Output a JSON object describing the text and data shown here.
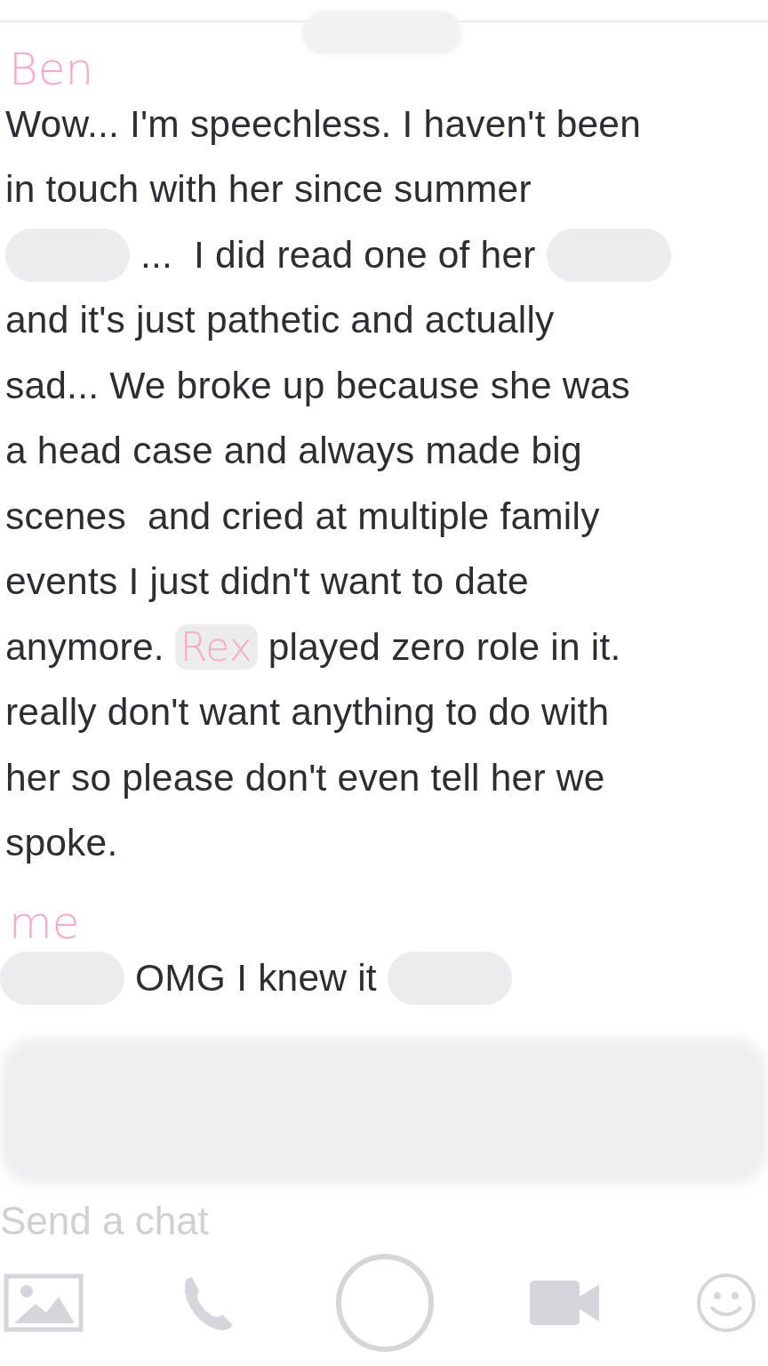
{
  "messages": [
    {
      "sender": "Ben",
      "lines": [
        [
          {
            "kind": "text",
            "text": "Wow... I'm speechless. I haven't been"
          }
        ],
        [
          {
            "kind": "text",
            "text": "in touch with her since summer"
          }
        ],
        [
          {
            "kind": "redacted"
          },
          {
            "kind": "text",
            "text": "...  I did read one of her"
          },
          {
            "kind": "redacted"
          }
        ],
        [
          {
            "kind": "text",
            "text": "and it's just pathetic and actually"
          }
        ],
        [
          {
            "kind": "text",
            "text": "sad... We broke up because she was"
          }
        ],
        [
          {
            "kind": "text",
            "text": "a head case and always made big"
          }
        ],
        [
          {
            "kind": "text",
            "text": "scenes  and cried at multiple family"
          }
        ],
        [
          {
            "kind": "text",
            "text": "events I just didn't want to date"
          }
        ],
        [
          {
            "kind": "text",
            "text": "anymore."
          },
          {
            "kind": "annotation",
            "text": "Rex"
          },
          {
            "kind": "text",
            "text": "played zero role in it."
          }
        ],
        [
          {
            "kind": "text",
            "text": "really don't want anything to do with"
          }
        ],
        [
          {
            "kind": "text",
            "text": "her so please don't even tell her we"
          }
        ],
        [
          {
            "kind": "text",
            "text": "spoke."
          }
        ]
      ]
    },
    {
      "sender": "me",
      "lines": [
        [
          {
            "kind": "redacted"
          },
          {
            "kind": "text",
            "text": "OMG I knew it"
          },
          {
            "kind": "redacted"
          }
        ]
      ]
    }
  ],
  "input": {
    "placeholder": "Send a chat"
  },
  "toolbar": [
    {
      "kind": "image"
    },
    {
      "kind": "call"
    },
    {
      "kind": "capture"
    },
    {
      "kind": "video"
    },
    {
      "kind": "emoji"
    }
  ]
}
